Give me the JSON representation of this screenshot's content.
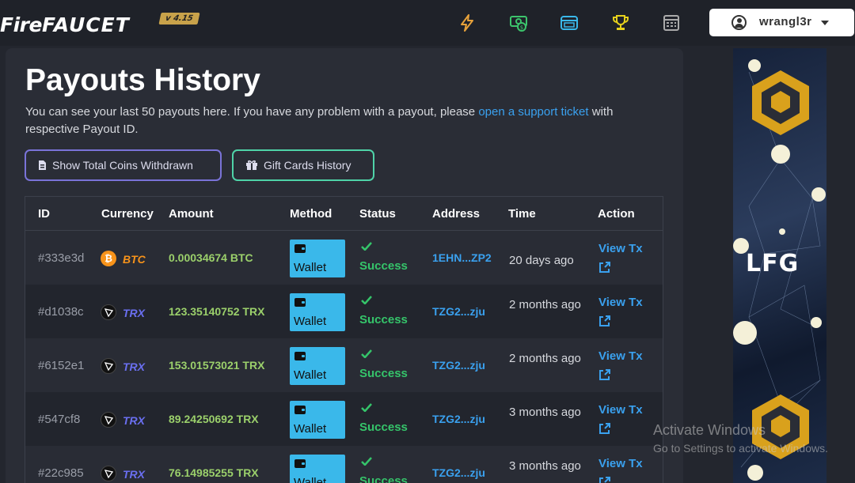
{
  "header": {
    "logo_fire": "Fire",
    "logo_faucet": "FAUCET",
    "version": "v 4.15",
    "nav_icons": [
      "bolt-icon",
      "money-icon",
      "wallet-icon",
      "trophy-icon",
      "calculator-icon"
    ],
    "username": "wrangl3r"
  },
  "page": {
    "title_bold": "Payouts",
    "title_rest": " History",
    "intro_before": "You can see your last 50 payouts here. If you have any problem with a payout, please ",
    "intro_link": "open a support ticket",
    "intro_after": " with respective Payout ID.",
    "btn_total": "Show Total Coins Withdrawn",
    "btn_gift": "Gift Cards History"
  },
  "table": {
    "headers": [
      "ID",
      "Currency",
      "Amount",
      "Method",
      "Status",
      "Address",
      "Time",
      "Action"
    ],
    "rows": [
      {
        "id": "#333e3d",
        "currency": "BTC",
        "coin": "btc",
        "amount": "0.00034674 BTC",
        "method": "Wallet",
        "status": "Success",
        "address": "1EHN...ZP2",
        "time": "20 days ago",
        "action": "View Tx"
      },
      {
        "id": "#d1038c",
        "currency": "TRX",
        "coin": "trx",
        "amount": "123.35140752 TRX",
        "method": "Wallet",
        "status": "Success",
        "address": "TZG2...zju",
        "time": "2 months ago",
        "action": "View Tx"
      },
      {
        "id": "#6152e1",
        "currency": "TRX",
        "coin": "trx",
        "amount": "153.01573021 TRX",
        "method": "Wallet",
        "status": "Success",
        "address": "TZG2...zju",
        "time": "2 months ago",
        "action": "View Tx"
      },
      {
        "id": "#547cf8",
        "currency": "TRX",
        "coin": "trx",
        "amount": "89.24250692 TRX",
        "method": "Wallet",
        "status": "Success",
        "address": "TZG2...zju",
        "time": "3 months ago",
        "action": "View Tx"
      },
      {
        "id": "#22c985",
        "currency": "TRX",
        "coin": "trx",
        "amount": "76.14985255 TRX",
        "method": "Wallet",
        "status": "Success",
        "address": "TZG2...zju",
        "time": "3 months ago",
        "action": "View Tx"
      }
    ]
  },
  "ad": {
    "text": "LFG"
  },
  "watermark": {
    "line1": "Activate Windows",
    "line2": "Go to Settings to activate Windows."
  },
  "colors": {
    "background": "#23262e",
    "card": "#2a2d36",
    "link": "#3aa1ef",
    "success": "#35c46a",
    "amount": "#9bd06b",
    "btc": "#f7931a",
    "trx": "#6a6ff0",
    "wallet": "#3ab8ea"
  }
}
